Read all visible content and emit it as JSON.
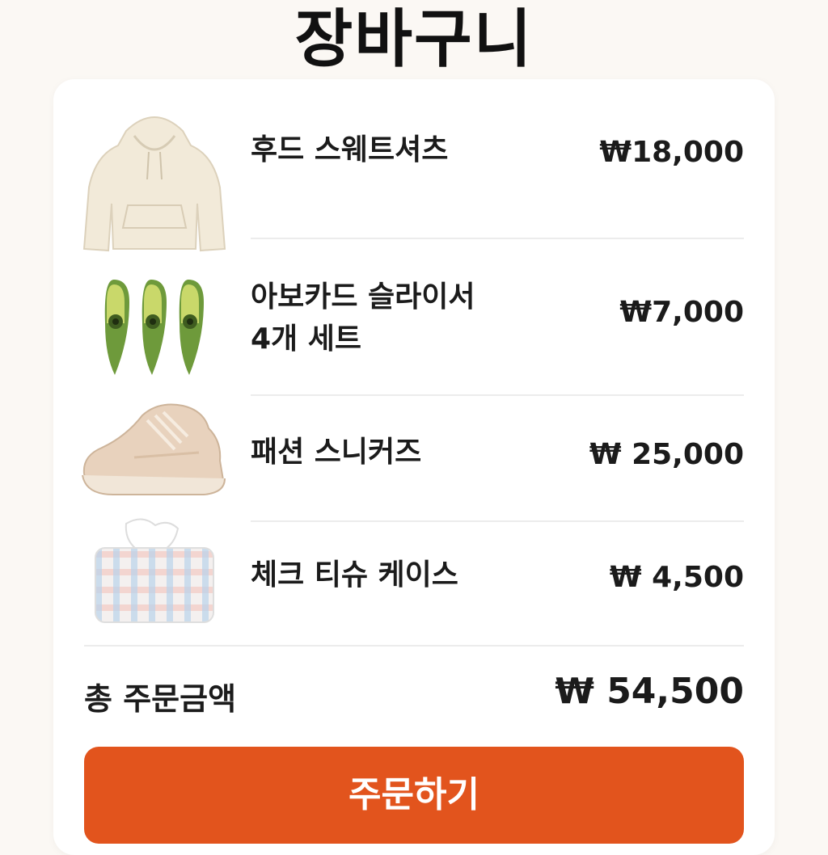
{
  "header": {
    "title": "장바구니"
  },
  "cart": {
    "items": [
      {
        "name": "후드 스웨트셔츠",
        "price": "₩18,000",
        "image": "hoodie-image"
      },
      {
        "name_line1": "아보카드 슬라이서",
        "name_line2": "4개 세트",
        "price": "₩7,000",
        "image": "avocado-slicer-image"
      },
      {
        "name": "패션 스니커즈",
        "price": "₩ 25,000",
        "image": "sneakers-image"
      },
      {
        "name": "체크 티슈 케이스",
        "price": "₩ 4,500",
        "image": "tissue-case-image"
      }
    ],
    "total_label": "총 주문금액",
    "total_value": "₩ 54,500"
  },
  "actions": {
    "order_label": "주문하기"
  },
  "colors": {
    "accent": "#e2541d",
    "background": "#fbf8f4",
    "card": "#ffffff"
  }
}
